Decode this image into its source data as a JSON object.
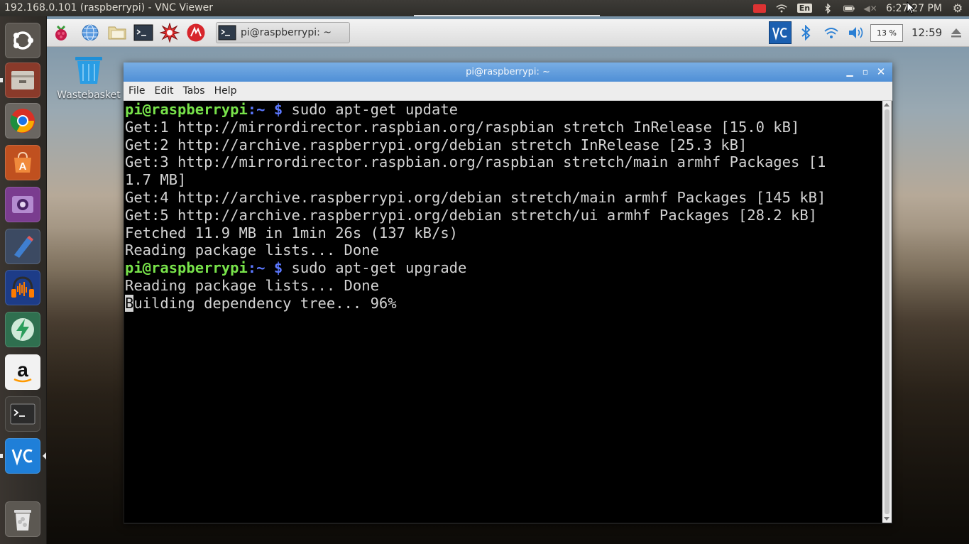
{
  "vnc_title": "192.168.0.101 (raspberrypi) - VNC Viewer",
  "ubuntu_tray": {
    "lang": "En",
    "time": "6:27:27 PM"
  },
  "launcher_items": [
    {
      "name": "ubuntu-dash-icon"
    },
    {
      "name": "files-icon"
    },
    {
      "name": "chrome-icon"
    },
    {
      "name": "software-center-icon"
    },
    {
      "name": "screen-recorder-icon"
    },
    {
      "name": "pencil-app-icon"
    },
    {
      "name": "audacity-icon"
    },
    {
      "name": "lightning-app-icon"
    },
    {
      "name": "amazon-icon"
    },
    {
      "name": "terminal-icon"
    },
    {
      "name": "vnc-viewer-icon"
    },
    {
      "name": "trash-icon"
    }
  ],
  "lx_panel": {
    "task_label": "pi@raspberrypi: ~",
    "cpu": "13 %",
    "clock": "12:59"
  },
  "desktop": {
    "wastebasket_label": "Wastebasket"
  },
  "terminal": {
    "title": "pi@raspberrypi: ~",
    "menu": [
      "File",
      "Edit",
      "Tabs",
      "Help"
    ],
    "prompt_user": "pi@raspberrypi",
    "prompt_path": ":~ $",
    "lines": [
      {
        "type": "cmd",
        "text": " sudo apt-get update"
      },
      {
        "type": "out",
        "text": "Get:1 http://mirrordirector.raspbian.org/raspbian stretch InRelease [15.0 kB]"
      },
      {
        "type": "out",
        "text": "Get:2 http://archive.raspberrypi.org/debian stretch InRelease [25.3 kB]"
      },
      {
        "type": "out",
        "text": "Get:3 http://mirrordirector.raspbian.org/raspbian stretch/main armhf Packages [1"
      },
      {
        "type": "out",
        "text": "1.7 MB]"
      },
      {
        "type": "out",
        "text": "Get:4 http://archive.raspberrypi.org/debian stretch/main armhf Packages [145 kB]"
      },
      {
        "type": "out",
        "text": "Get:5 http://archive.raspberrypi.org/debian stretch/ui armhf Packages [28.2 kB]"
      },
      {
        "type": "out",
        "text": "Fetched 11.9 MB in 1min 26s (137 kB/s)"
      },
      {
        "type": "out",
        "text": "Reading package lists... Done"
      },
      {
        "type": "cmd",
        "text": " sudo apt-get upgrade"
      },
      {
        "type": "out",
        "text": "Reading package lists... Done"
      },
      {
        "type": "cursor",
        "cursor_char": "B",
        "text": "uilding dependency tree... 96%"
      }
    ]
  },
  "colors": {
    "prompt_user": "#78e34a",
    "prompt_path": "#5c78ff",
    "terminal_fg": "#d3d3d3",
    "titlebar": "#5f9ddd"
  }
}
